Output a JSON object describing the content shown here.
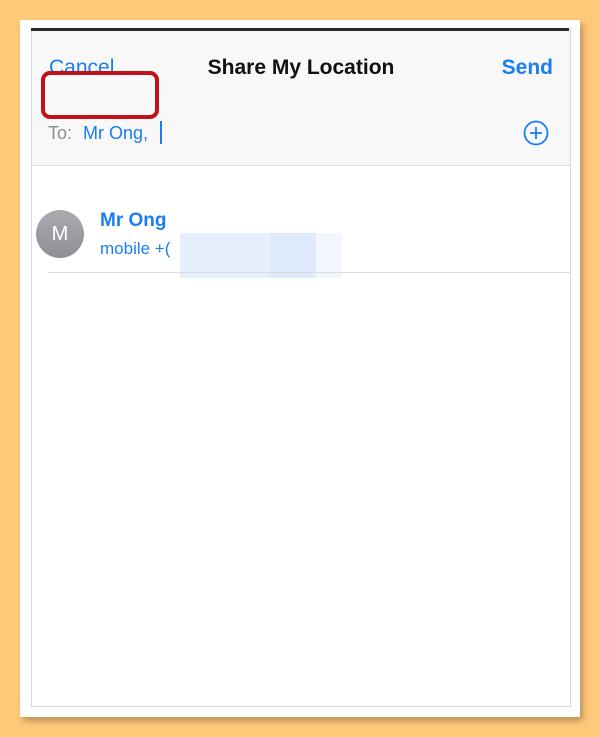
{
  "nav": {
    "cancel_label": "Cancel",
    "title": "Share My Location",
    "send_label": "Send"
  },
  "to_field": {
    "label": "To:",
    "recipient": "Mr Ong,"
  },
  "icons": {
    "add_contact": "plus-circle-icon"
  },
  "contact": {
    "avatar_initial": "M",
    "name": "Mr Ong",
    "detail": "mobile +("
  },
  "colors": {
    "accent": "#1a7ef2",
    "highlight": "#c0121a",
    "background": "#FFC979"
  }
}
